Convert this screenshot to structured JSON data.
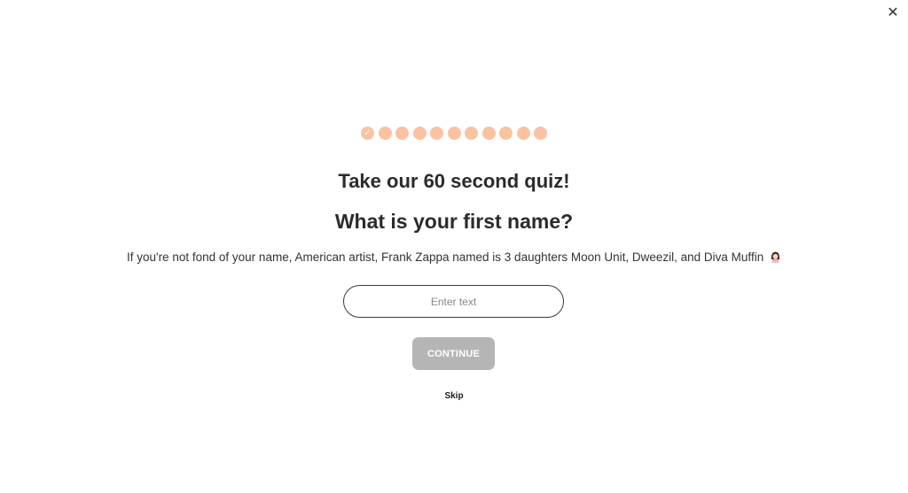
{
  "close": {
    "icon": "close-icon",
    "glyph": "✕"
  },
  "progress": {
    "total_steps": 11,
    "completed_steps": 1,
    "check_glyph": "✓",
    "dot_color": "#f9c2a0"
  },
  "quiz": {
    "title": "Take our 60 second quiz!",
    "question": "What is your first name?",
    "description": "If you're not fond of your name, American artist, Frank Zappa named is 3 daughters Moon Unit, Dweezil, and Diva Muffin",
    "description_icon": "woman-gesturing-emoji"
  },
  "name_field": {
    "value": "",
    "placeholder": "Enter text"
  },
  "continue": {
    "label": "CONTINUE",
    "color": "#b5b5b5",
    "disabled": true
  },
  "skip": {
    "label": "Skip"
  }
}
